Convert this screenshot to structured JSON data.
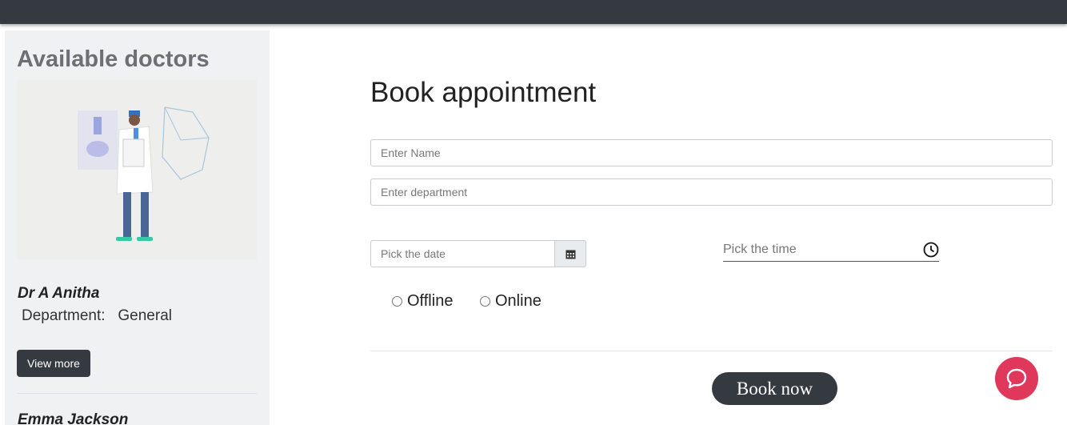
{
  "sidebar": {
    "heading": "Available doctors",
    "doctors": [
      {
        "name": "Dr A Anitha",
        "department_label": "Department:",
        "department": "General",
        "button": "View more"
      },
      {
        "name": "Emma Jackson"
      }
    ]
  },
  "form": {
    "title": "Book appointment",
    "name_placeholder": "Enter Name",
    "department_placeholder": "Enter department",
    "date_placeholder": "Pick the date",
    "time_placeholder": "Pick the time",
    "modes": [
      "Offline",
      "Online"
    ],
    "submit": "Book now"
  },
  "colors": {
    "dark": "#343a40",
    "chat_accent": "#e0385a",
    "sidebar_bg": "#f0f1f3"
  },
  "icons": [
    "calendar-icon",
    "clock-icon",
    "chat-icon",
    "doctor-illustration"
  ]
}
